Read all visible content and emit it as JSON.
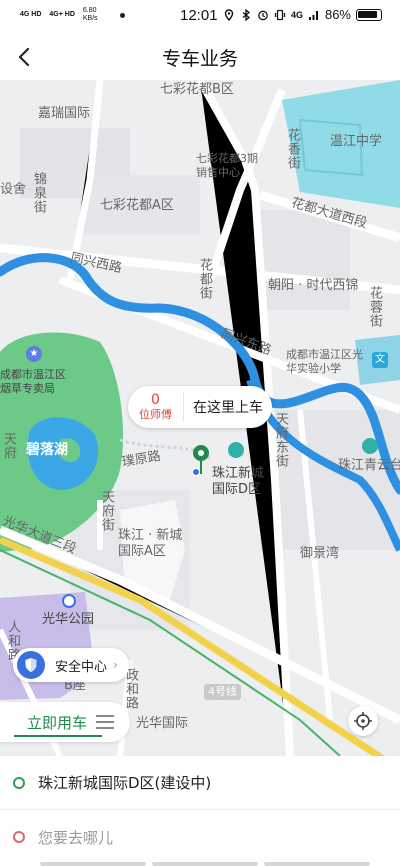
{
  "status_bar": {
    "signal_1": "4G HD",
    "signal_2": "4G+ HD",
    "net_speed": "6.80",
    "net_speed_unit": "KB/s",
    "time": "12:01",
    "network": "4G",
    "battery": "86%"
  },
  "header": {
    "title": "专车业务"
  },
  "map": {
    "labels": {
      "qicaihuadu_b": "七彩花都B区",
      "jiarui": "嘉瑞国际",
      "wenjiang_middle": "温江中学",
      "sales_center": "七彩花都3期销售中心",
      "qicaihuadu_a": "七彩花都A区",
      "huaxiang_street": "花香街",
      "huadu_road": "花都大道西段",
      "jinquan_street": "锦泉街",
      "tongxing_west": "同兴西路",
      "huadu_street": "花都街",
      "chaoyang": "朝阳 · 时代西锦",
      "huaxi_street": "花蓉街",
      "tongxing_east": "同兴东路",
      "guanghua_school": "成都市温江区光华实验小学",
      "wenjiang_bureau": "成都市温江区烟草专卖局",
      "biluo_lake": "碧落湖",
      "tianxing_road": "天府东街",
      "jieyuan_road": "璞原路",
      "zhujiang_d": "珠江新城国际D区",
      "zhujiang_qingyun": "珠江青云台",
      "tianfu_street": "天府街",
      "zhujiang_a": "珠江 · 新城国际A区",
      "yujing_bay": "御景湾",
      "avenue_3": "光华大道三段",
      "guanghua_park": "光华公园",
      "b_seat": "B座",
      "metro_4": "4号线",
      "zhenghe_road": "政和路",
      "guanghua_intl": "光华国际",
      "hehua_road": "人和路",
      "left_edge": "设舍"
    },
    "pickup": {
      "driver_count": "0",
      "driver_unit": "位师傅",
      "label": "在这里上车"
    },
    "safety_center": "安全中心"
  },
  "tabs": {
    "now_label": "立即用车"
  },
  "trip": {
    "from": "珠江新城国际D区(建设中)",
    "to_placeholder": "您要去哪儿"
  },
  "colors": {
    "brand_green": "#1f8a4c",
    "river_blue": "#2f8fe0",
    "park_green": "#6cc987",
    "metro_yellow": "#f2d24b"
  }
}
